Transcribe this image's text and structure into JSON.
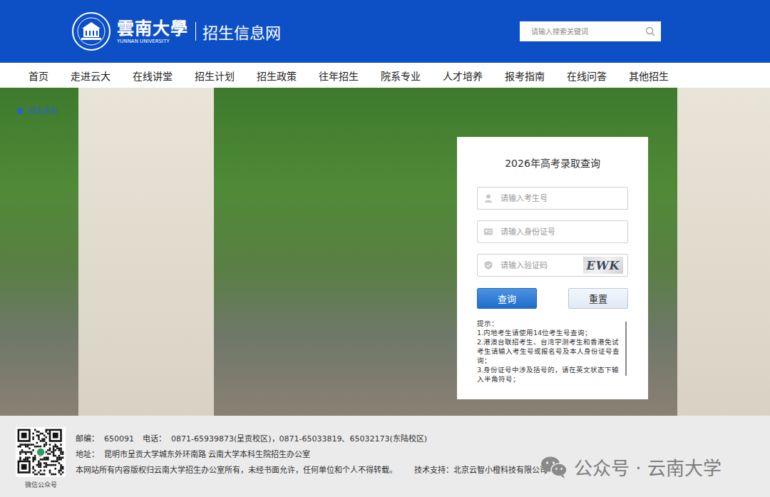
{
  "header": {
    "logo_name": "雲南大學",
    "logo_en": "YUNNAN UNIVERSITY",
    "site_title": "招生信息网",
    "search": {
      "placeholder": "请输入搜索关键词"
    }
  },
  "nav": [
    {
      "label": "首页"
    },
    {
      "label": "走进云大"
    },
    {
      "label": "在线讲堂"
    },
    {
      "label": "招生计划"
    },
    {
      "label": "招生政策"
    },
    {
      "label": "往年招生"
    },
    {
      "label": "院系专业"
    },
    {
      "label": "人才培养"
    },
    {
      "label": "报考指南"
    },
    {
      "label": "在线问答"
    },
    {
      "label": "其他招生"
    }
  ],
  "breadcrumb": {
    "label": "招生查询"
  },
  "query_card": {
    "title": "2026年高考录取查询",
    "fields": [
      {
        "kind": "user",
        "placeholder": "请输入考生号"
      },
      {
        "kind": "idcard",
        "placeholder": "请输入身份证号"
      },
      {
        "kind": "captcha",
        "placeholder": "请输入验证码",
        "captcha": "EWK"
      }
    ],
    "buttons": [
      {
        "label": "查询",
        "kind": "primary"
      },
      {
        "label": "重置",
        "kind": "secondary"
      }
    ],
    "tips_title": "提示：",
    "tips": [
      "1.内地考生请使用14位考生号查询；",
      "2.港澳台联招考生、台湾学测考生和香港免试考生请输入考生号或报名号及本人身份证号查询；",
      "3.身份证号中涉及括号的，请在英文状态下输入半角符号；"
    ]
  },
  "footer": {
    "qr_caption": "微信公众号",
    "rows": [
      [
        "邮编：  650091",
        "电话：  0871-65939873(呈贡校区)，0871-65033819、65032173(东陆校区)"
      ],
      [
        "地址：  昆明市呈贡大学城东外环南路 云南大学本科生院招生办公室"
      ],
      [
        "本网站所有内容版权归云南大学招生办公室所有，未经书面允许，任何单位和个人不得转载。",
        "技术支持：北京云智小橙科技有限公司"
      ]
    ]
  },
  "watermark": "公众号 · 云南大学"
}
